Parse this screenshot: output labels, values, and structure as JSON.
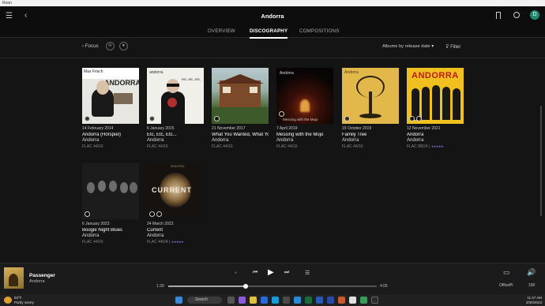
{
  "window": {
    "title": "Roon"
  },
  "header": {
    "title": "Andorra"
  },
  "tabs": [
    {
      "label": "OVERVIEW",
      "active": false
    },
    {
      "label": "DISCOGRAPHY",
      "active": true
    },
    {
      "label": "COMPOSITIONS",
      "active": false
    }
  ],
  "toolbar": {
    "focus_label": "Focus",
    "sort_label": "Albums by release date",
    "filter_label": "Filter"
  },
  "albums": [
    {
      "date": "14 February 2014",
      "title": "Andorra (Hörspiel)",
      "artist": "Andorra",
      "format": "FLAC 44/16",
      "rating": "",
      "cover_text": "ANDORRA",
      "cover_subtext": "Max Frisch"
    },
    {
      "date": "6 January 2015",
      "title": "Etc, Etc, Etc...",
      "artist": "Andorra",
      "format": "FLAC 44/16",
      "rating": "",
      "cover_text": "andorra",
      "cover_subtext": "etc..etc..etc.."
    },
    {
      "date": "21 November 2017",
      "title": "What You Wanted, What You Got",
      "artist": "Andorra",
      "format": "FLAC 44/16",
      "rating": ""
    },
    {
      "date": "7 April 2019",
      "title": "Messing with the Mojo",
      "artist": "Andorra",
      "format": "FLAC 44/16",
      "rating": "",
      "cover_text": "Andorra",
      "cover_subtext": "Messing with the Mojo"
    },
    {
      "date": "15 October 2019",
      "title": "Family Tree",
      "artist": "Andorra",
      "format": "FLAC 44/16",
      "rating": "",
      "cover_text": "Andorra"
    },
    {
      "date": "12 November 2021",
      "title": "Andorra",
      "artist": "Andorra",
      "format": "FLAC 88/24 |",
      "rating": "★★★★★",
      "cover_text": "ANDORRA"
    },
    {
      "date": "6 January 2023",
      "title": "Boogie Night Blues",
      "artist": "Andorra",
      "format": "FLAC 44/16",
      "rating": ""
    },
    {
      "date": "24 March 2023",
      "title": "Current",
      "artist": "Andorra",
      "format": "FLAC 44/24 |",
      "rating": "★★★★★",
      "cover_text": "CURRENT",
      "cover_subtext": "ANDORRA"
    }
  ],
  "player": {
    "title": "Passenger",
    "artist": "Andorra",
    "elapsed": "1:30",
    "duration": "4:05",
    "progress": 0.37,
    "zone": "OfficePi",
    "volume": "100"
  },
  "taskbar": {
    "weather_temp": "53°F",
    "weather_desc": "Partly sunny",
    "search": "Search",
    "time": "11:47 AM",
    "date": "3/30/2023"
  },
  "colors": {
    "accent": "#7878d8",
    "avatar": "#1f8a70"
  }
}
